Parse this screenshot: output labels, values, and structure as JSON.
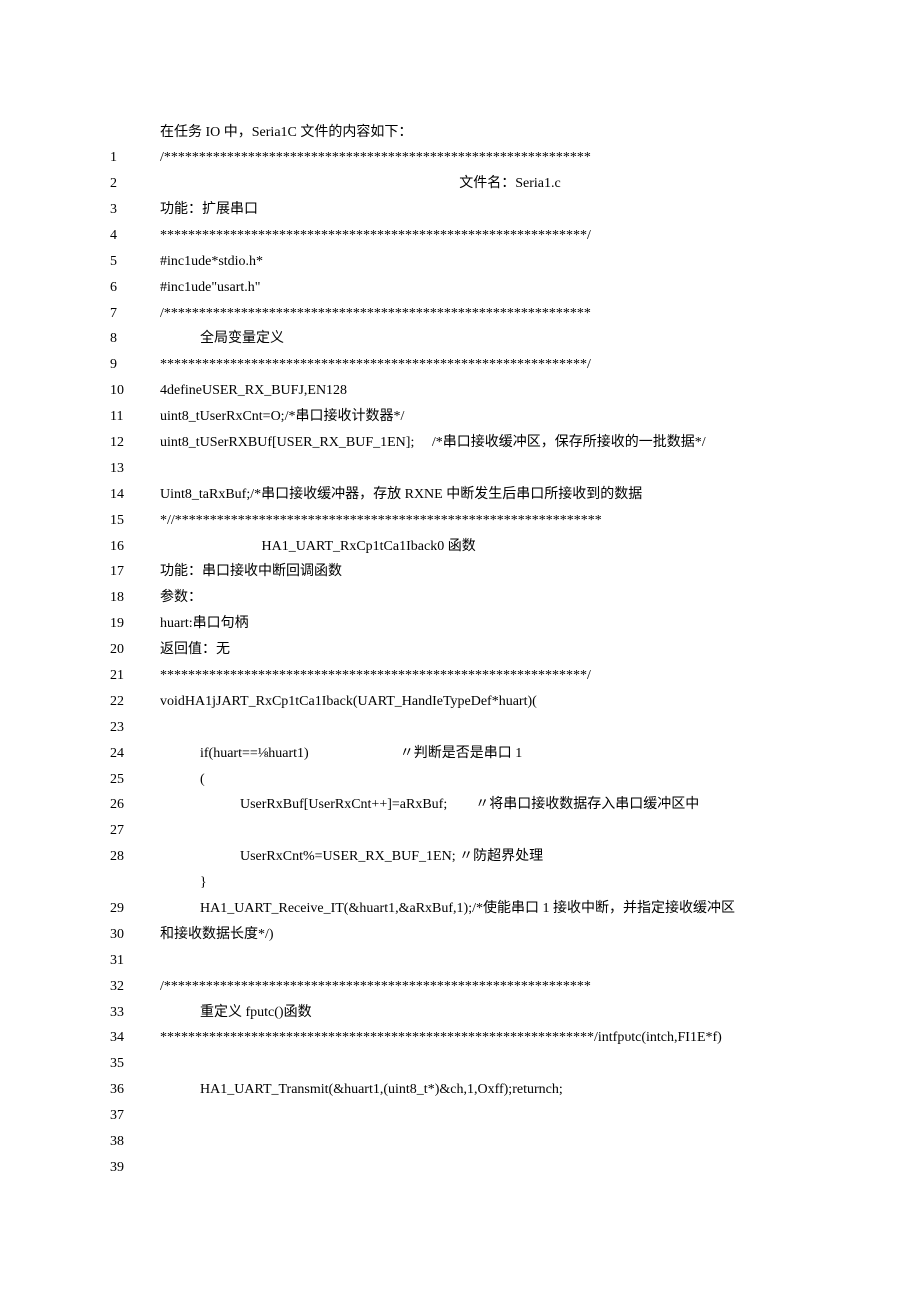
{
  "intro": "在任务 IO 中，Seria1C 文件的内容如下：",
  "lines": [
    {
      "n": "1",
      "c": "/*************************************************************"
    },
    {
      "n": "2",
      "c": "文件名：Seria1.c",
      "cls": "center-text"
    },
    {
      "n": "3",
      "c": "功能：扩展串口"
    },
    {
      "n": "4",
      "c": "*************************************************************/"
    },
    {
      "n": "5",
      "c": "#inc1ude*stdio.h*"
    },
    {
      "n": "6",
      "c": "#inc1ude\"usart.h\""
    },
    {
      "n": "7",
      "c": "/*************************************************************"
    },
    {
      "n": "8",
      "c": "全局变量定义",
      "cls": "indent1"
    },
    {
      "n": "9",
      "c": "*************************************************************/"
    },
    {
      "n": "10",
      "c": "4defineUSER_RX_BUFJ,EN128"
    },
    {
      "n": "11",
      "c": "uint8_tUserRxCnt=O;/*串口接收计数器*/"
    },
    {
      "n": "12",
      "c": "uint8_tUSerRXBUf[USER_RX_BUF_1EN];     /*串口接收缓冲区，保存所接收的一批数据*/"
    },
    {
      "n": "13",
      "c": ""
    },
    {
      "n": "14",
      "c": "Uint8_taRxBuf;/*串口接收缓冲器，存放 RXNE 中断发生后串口所接收到的数据"
    },
    {
      "n": "15",
      "c": "*//*************************************************************"
    },
    {
      "n": "16",
      "c": "                             HA1_UART_RxCp1tCa1Iback0 函数"
    },
    {
      "n": "17",
      "c": "功能：串口接收中断回调函数"
    },
    {
      "n": "18",
      "c": "参数："
    },
    {
      "n": "19",
      "c": "huart:串口句柄"
    },
    {
      "n": "20",
      "c": "返回值：无"
    },
    {
      "n": "21",
      "c": "*************************************************************/"
    },
    {
      "n": "22",
      "c": "voidHA1jJART_RxCp1tCa1Iback(UART_HandIeTypeDef*huart)("
    },
    {
      "n": "23",
      "c": ""
    },
    {
      "n": "24",
      "c": "if(huart==⅛huart1)                          〃判断是否是串口 1",
      "cls": "indent1"
    },
    {
      "n": "25",
      "c": "(",
      "cls": "indent1"
    },
    {
      "n": "26",
      "c": "UserRxBuf[UserRxCnt++]=aRxBuf;        〃将串口接收数据存入串口缓冲区中",
      "cls": "indent2"
    },
    {
      "n": "27",
      "c": ""
    },
    {
      "n": "28",
      "c": "UserRxCnt%=USER_RX_BUF_1EN; 〃防超界处理",
      "cls": "indent2"
    },
    {
      "n": "",
      "c": "}",
      "cls": "indent1"
    },
    {
      "n": "29",
      "c": "HA1_UART_Receive_IT(&huart1,&aRxBuf,1);/*使能串口 1 接收中断，并指定接收缓冲区",
      "cls": "indent1"
    },
    {
      "n": "30",
      "c": "和接收数据长度*/)"
    },
    {
      "n": "31",
      "c": ""
    },
    {
      "n": "32",
      "c": "/*************************************************************"
    },
    {
      "n": "33",
      "c": "重定义 fputc()函数",
      "cls": "indent1"
    },
    {
      "n": "34",
      "c": "**************************************************************/intfpυtc(intch,FI1E*f)"
    },
    {
      "n": "35",
      "c": ""
    },
    {
      "n": "36",
      "c": "HA1_UART_Transmit(&huart1,(uint8_t*)&ch,1,Oxff);returnch;",
      "cls": "indent1"
    },
    {
      "n": "37",
      "c": ""
    },
    {
      "n": "38",
      "c": ""
    },
    {
      "n": "39",
      "c": ""
    }
  ]
}
